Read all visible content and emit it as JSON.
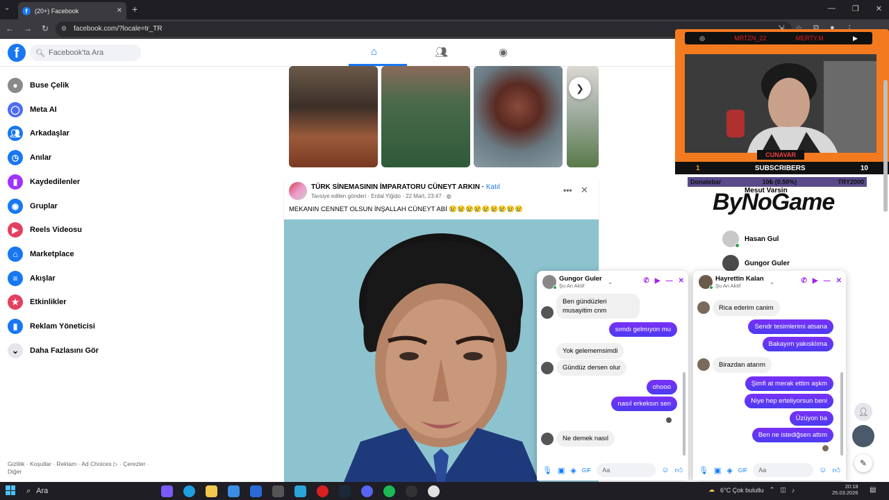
{
  "browser": {
    "tab_title": "(20+) Facebook",
    "url": "facebook.com/?locale=tr_TR"
  },
  "header": {
    "search_placeholder": "Facebook'ta Ara"
  },
  "sidebar": {
    "items": [
      {
        "label": "Buse Çelik",
        "icon": "profile-avatar",
        "color": "#8a8a8a"
      },
      {
        "label": "Meta AI",
        "icon": "meta-ai-ring",
        "color": "#4d6cf2"
      },
      {
        "label": "Arkadaşlar",
        "icon": "friends-icon",
        "color": "#1877f2"
      },
      {
        "label": "Anılar",
        "icon": "memories-clock-icon",
        "color": "#1877f2"
      },
      {
        "label": "Kaydedilenler",
        "icon": "bookmark-icon",
        "color": "#a033ff"
      },
      {
        "label": "Gruplar",
        "icon": "groups-icon",
        "color": "#1877f2"
      },
      {
        "label": "Reels Videosu",
        "icon": "reels-icon",
        "color": "#e4405f"
      },
      {
        "label": "Marketplace",
        "icon": "marketplace-icon",
        "color": "#1877f2"
      },
      {
        "label": "Akışlar",
        "icon": "feeds-icon",
        "color": "#1877f2"
      },
      {
        "label": "Etkinlikler",
        "icon": "events-icon",
        "color": "#e4405f"
      },
      {
        "label": "Reklam Yöneticisi",
        "icon": "ads-manager-icon",
        "color": "#1877f2"
      },
      {
        "label": "Daha Fazlasını Gör",
        "icon": "chevron-down-icon",
        "color": "#e4e6eb"
      }
    ],
    "footer": "Gizlilik · Koşullar · Reklam · Ad Choices ▷ · Çerezler · Diğer"
  },
  "post": {
    "page_name": "TÜRK SİNEMASININ İMPARATORU CÜNEYT ARKIN",
    "join_label": "Katıl",
    "subtitle": "Tavsiye edilen gönderi · Erdal Yiğido · 22 Mart, 23:47 · ",
    "text": "MEKANIN CENNET OLSUN İNŞALLAH CÜNEYT ABİ 😢😢😢😢😢😢😢😢😢"
  },
  "stream": {
    "left_tag": "MRTZN_22",
    "right_tag": "MERTY.M",
    "streamer_name": "CUNAVAR",
    "subs_label": "SUBSCRIBERS",
    "subs_left": "1",
    "subs_right": "10",
    "donate_left": "Donatebar",
    "donate_mid": "10₺ (0.50%)",
    "donate_right": "TRY2000",
    "sponsor": "ByNoGame"
  },
  "contacts": [
    {
      "name": "Mesut Varsin"
    },
    {
      "name": "Hasan Gul"
    },
    {
      "name": "Gungor Guler"
    }
  ],
  "chat1": {
    "name": "Gungor Guler",
    "status": "Şu An Aktif",
    "messages": [
      {
        "dir": "in",
        "text": "Ben gündüzleri musayitim cnm"
      },
      {
        "dir": "out",
        "text": "sımdı gelmıyon mu"
      },
      {
        "dir": "in",
        "text": "Yok gelememsimdi"
      },
      {
        "dir": "in",
        "text": "Gündüz dersen olur"
      },
      {
        "dir": "out",
        "text": "ohooo"
      },
      {
        "dir": "out",
        "text": "nasıl erkeksın sen"
      },
      {
        "dir": "in",
        "text": "Ne demek nasıl"
      }
    ],
    "input_placeholder": "Aa"
  },
  "chat2": {
    "name": "Hayrettin Kalan",
    "status": "Şu An Aktif",
    "messages": [
      {
        "dir": "in",
        "text": "Rica ederim canim"
      },
      {
        "dir": "out",
        "text": "Sendr tesimlerimi atsana"
      },
      {
        "dir": "out",
        "text": "Bakayım yakısklıma"
      },
      {
        "dir": "in",
        "text": "Birazdan atarım"
      },
      {
        "dir": "out",
        "text": "Şimfi at merak ettim aşkm"
      },
      {
        "dir": "out",
        "text": "Niye hep erteliyorsun beni"
      },
      {
        "dir": "out",
        "text": "Üzüyon ba"
      },
      {
        "dir": "out",
        "text": "Ben ne istediğsen attım"
      }
    ],
    "input_placeholder": "Aa"
  },
  "taskbar": {
    "search": "Ara",
    "weather": "6°C  Çok bulutlu",
    "time": "20:18",
    "date": "25.03.2026"
  }
}
